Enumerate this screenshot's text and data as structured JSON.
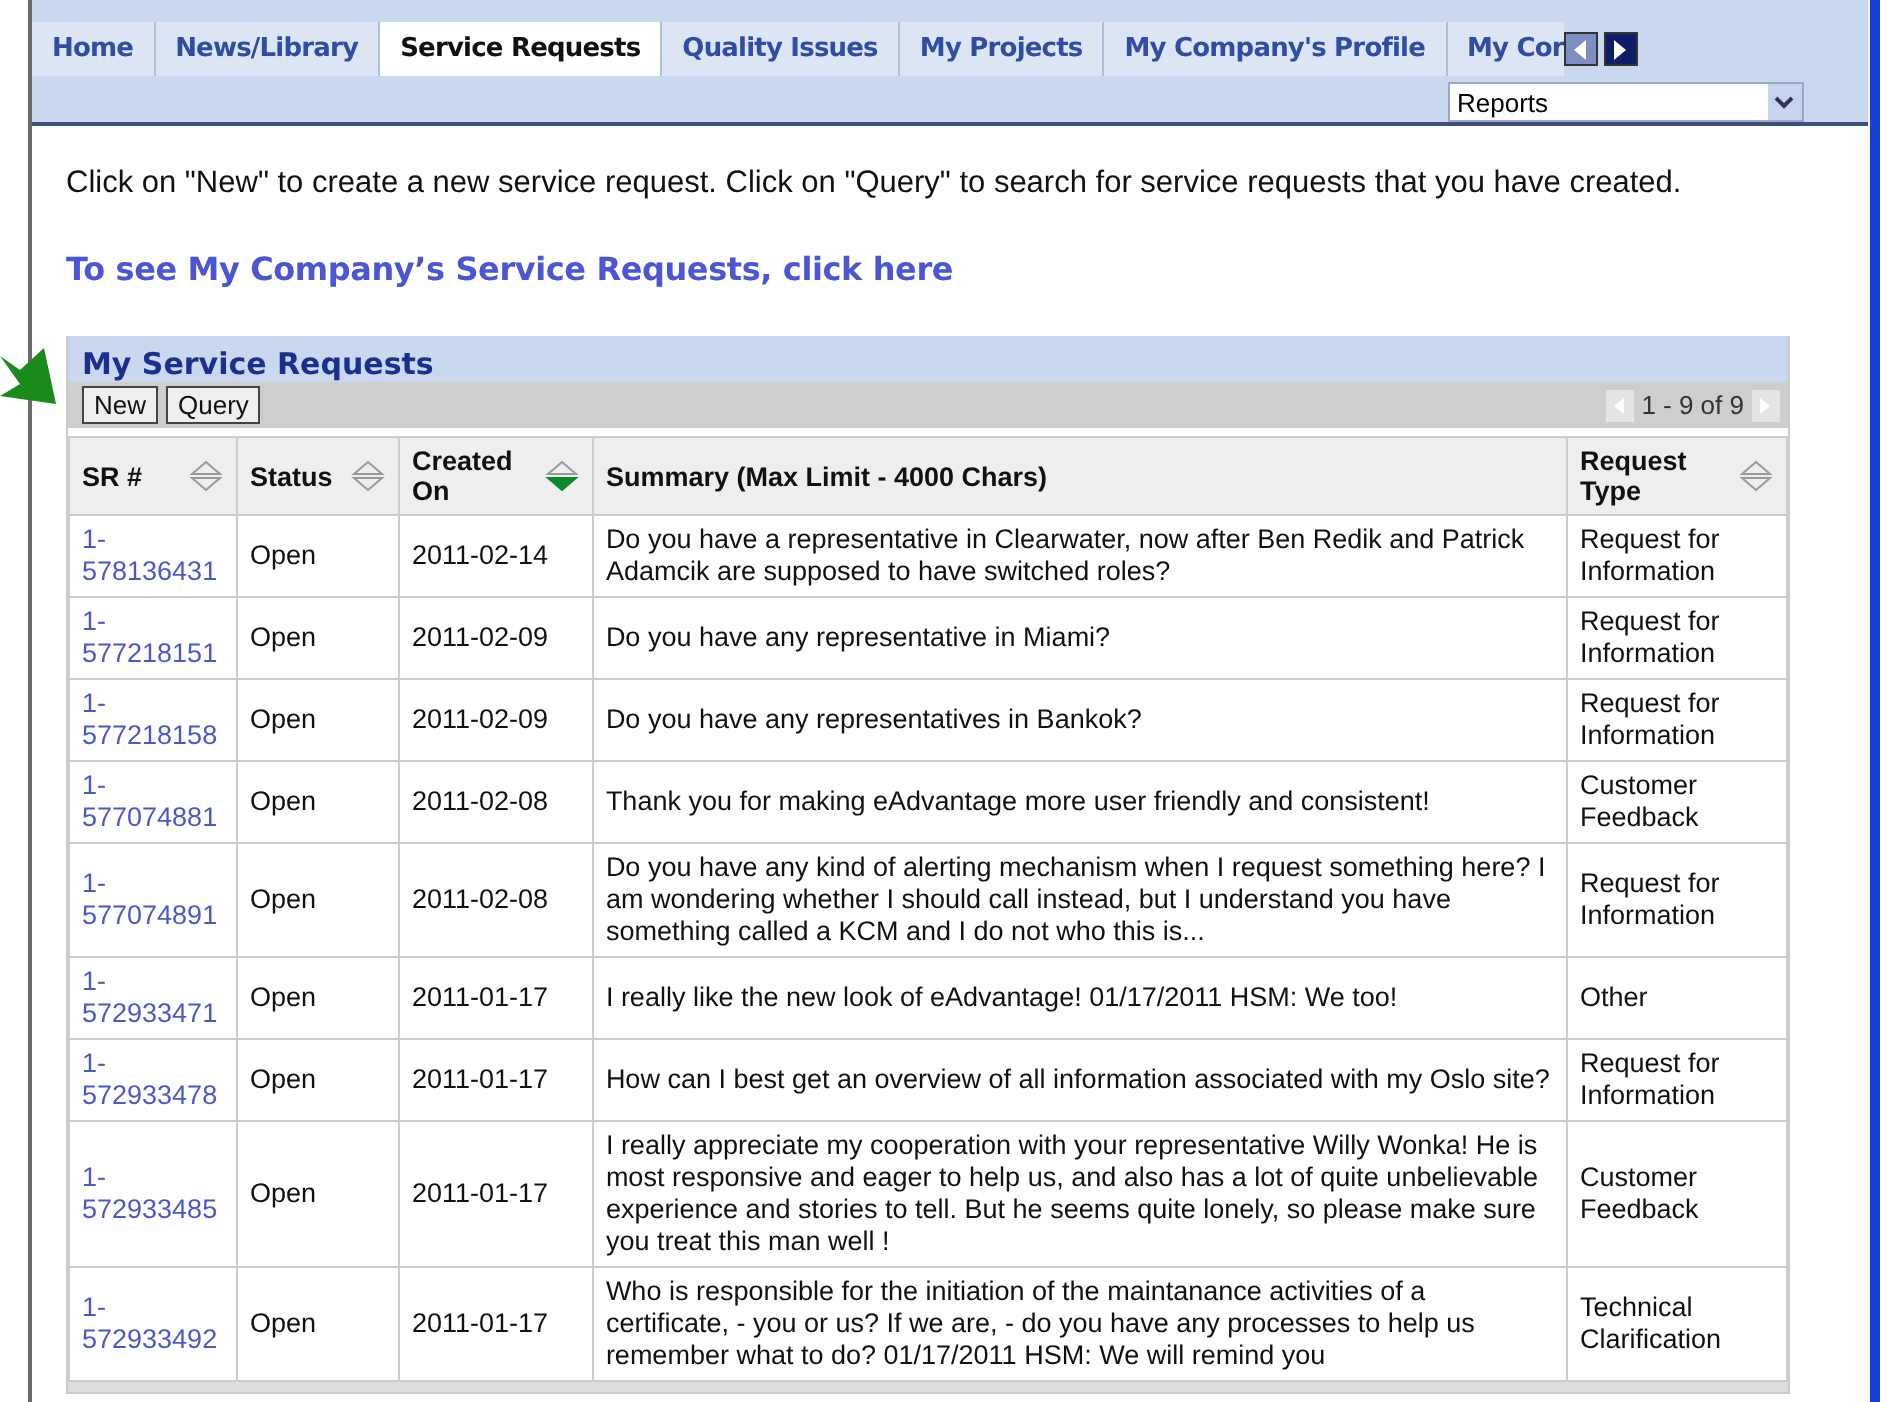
{
  "tabs": [
    {
      "label": "Home",
      "selected": false
    },
    {
      "label": "News/Library",
      "selected": false
    },
    {
      "label": "Service Requests",
      "selected": true
    },
    {
      "label": "Quality Issues",
      "selected": false
    },
    {
      "label": "My Projects",
      "selected": false
    },
    {
      "label": "My Company's Profile",
      "selected": false
    },
    {
      "label": "My Cor",
      "selected": false
    }
  ],
  "tab_dropdown": {
    "value": "Reports"
  },
  "intro": "Click on \"New\" to create a new service request. Click on \"Query\" to search for service requests that you have created.",
  "company_link": "To see My Company’s Service Requests, click here",
  "panel": {
    "title": "My Service Requests",
    "buttons": [
      "New",
      "Query"
    ],
    "pager": "1 - 9 of 9",
    "columns": [
      {
        "label": "SR #",
        "sorted": false
      },
      {
        "label": "Status",
        "sorted": false
      },
      {
        "label": "Created On",
        "sorted": true
      },
      {
        "label": "Summary (Max Limit - 4000 Chars)"
      },
      {
        "label": "Request Type",
        "sorted": false
      }
    ],
    "rows": [
      {
        "sr": "1-578136431",
        "status": "Open",
        "created": "2011-02-14",
        "summary": "Do you have a representative in Clearwater, now after Ben Redik and Patrick Adamcik are supposed to have switched roles?",
        "type": "Request for Information"
      },
      {
        "sr": "1-577218151",
        "status": "Open",
        "created": "2011-02-09",
        "summary": "Do you have any representative in Miami?",
        "type": "Request for Information"
      },
      {
        "sr": "1-577218158",
        "status": "Open",
        "created": "2011-02-09",
        "summary": "Do you have any representatives in Bankok?",
        "type": "Request for Information"
      },
      {
        "sr": "1-577074881",
        "status": "Open",
        "created": "2011-02-08",
        "summary": "Thank you for making eAdvantage more user friendly and consistent!",
        "type": "Customer Feedback"
      },
      {
        "sr": "1-577074891",
        "status": "Open",
        "created": "2011-02-08",
        "summary": "Do you have any kind of alerting mechanism when I request something here? I am wondering whether I should call instead, but I understand you have something called a KCM and I do not who this is...",
        "type": "Request for Information"
      },
      {
        "sr": "1-572933471",
        "status": "Open",
        "created": "2011-01-17",
        "summary": "I really like the new look of eAdvantage! 01/17/2011 HSM: We too!",
        "type": "Other"
      },
      {
        "sr": "1-572933478",
        "status": "Open",
        "created": "2011-01-17",
        "summary": "How can I best get an overview of all information associated with my Oslo site?",
        "type": "Request for Information"
      },
      {
        "sr": "1-572933485",
        "status": "Open",
        "created": "2011-01-17",
        "summary": "I really appreciate my cooperation with your representative Willy Wonka! He is most responsive and eager to help us, and also has a lot of quite unbelievable experience and stories to tell. But he seems quite lonely, so please make sure you treat this man well !",
        "type": "Customer Feedback"
      },
      {
        "sr": "1-572933492",
        "status": "Open",
        "created": "2011-01-17",
        "summary": "Who is responsible for the initiation of the maintanance activities of a certificate, - you or us? If we are, - do you have any processes to help us remember what to do? 01/17/2011 HSM: We will remind you",
        "type": "Technical Clarification"
      }
    ]
  }
}
